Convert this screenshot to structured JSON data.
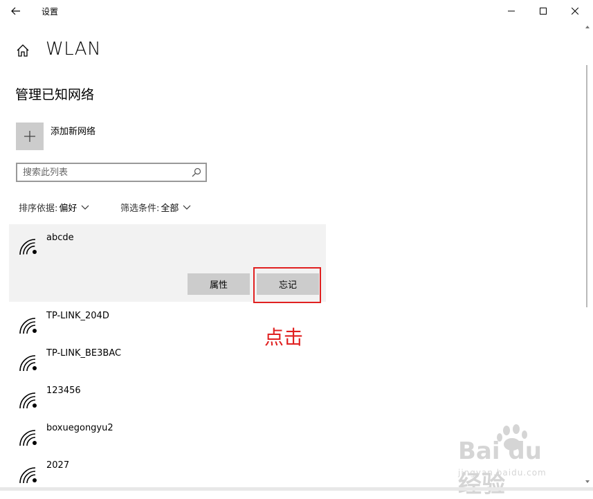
{
  "window": {
    "title": "设置",
    "icons": {
      "back": "back-arrow-icon",
      "minimize": "minimize-icon",
      "maximize": "maximize-icon",
      "close": "close-icon"
    }
  },
  "page": {
    "title": "WLAN",
    "home_icon": "home-icon"
  },
  "section": {
    "title": "管理已知网络",
    "add_label": "添加新网络",
    "search_placeholder": "搜索此列表"
  },
  "sort": {
    "label": "排序依据:",
    "value": "偏好"
  },
  "filter": {
    "label": "筛选条件:",
    "value": "全部"
  },
  "networks": [
    {
      "name": "abcde",
      "selected": true
    },
    {
      "name": "TP-LINK_204D"
    },
    {
      "name": "TP-LINK_BE3BAC"
    },
    {
      "name": "123456"
    },
    {
      "name": "boxuegongyu2"
    },
    {
      "name": "2027"
    }
  ],
  "selected_actions": {
    "properties": "属性",
    "forget": "忘记"
  },
  "annotation": {
    "text": "点击",
    "color": "#e02020"
  },
  "colors": {
    "button_bg": "#cccccc",
    "selected_bg": "#f2f2f2"
  }
}
